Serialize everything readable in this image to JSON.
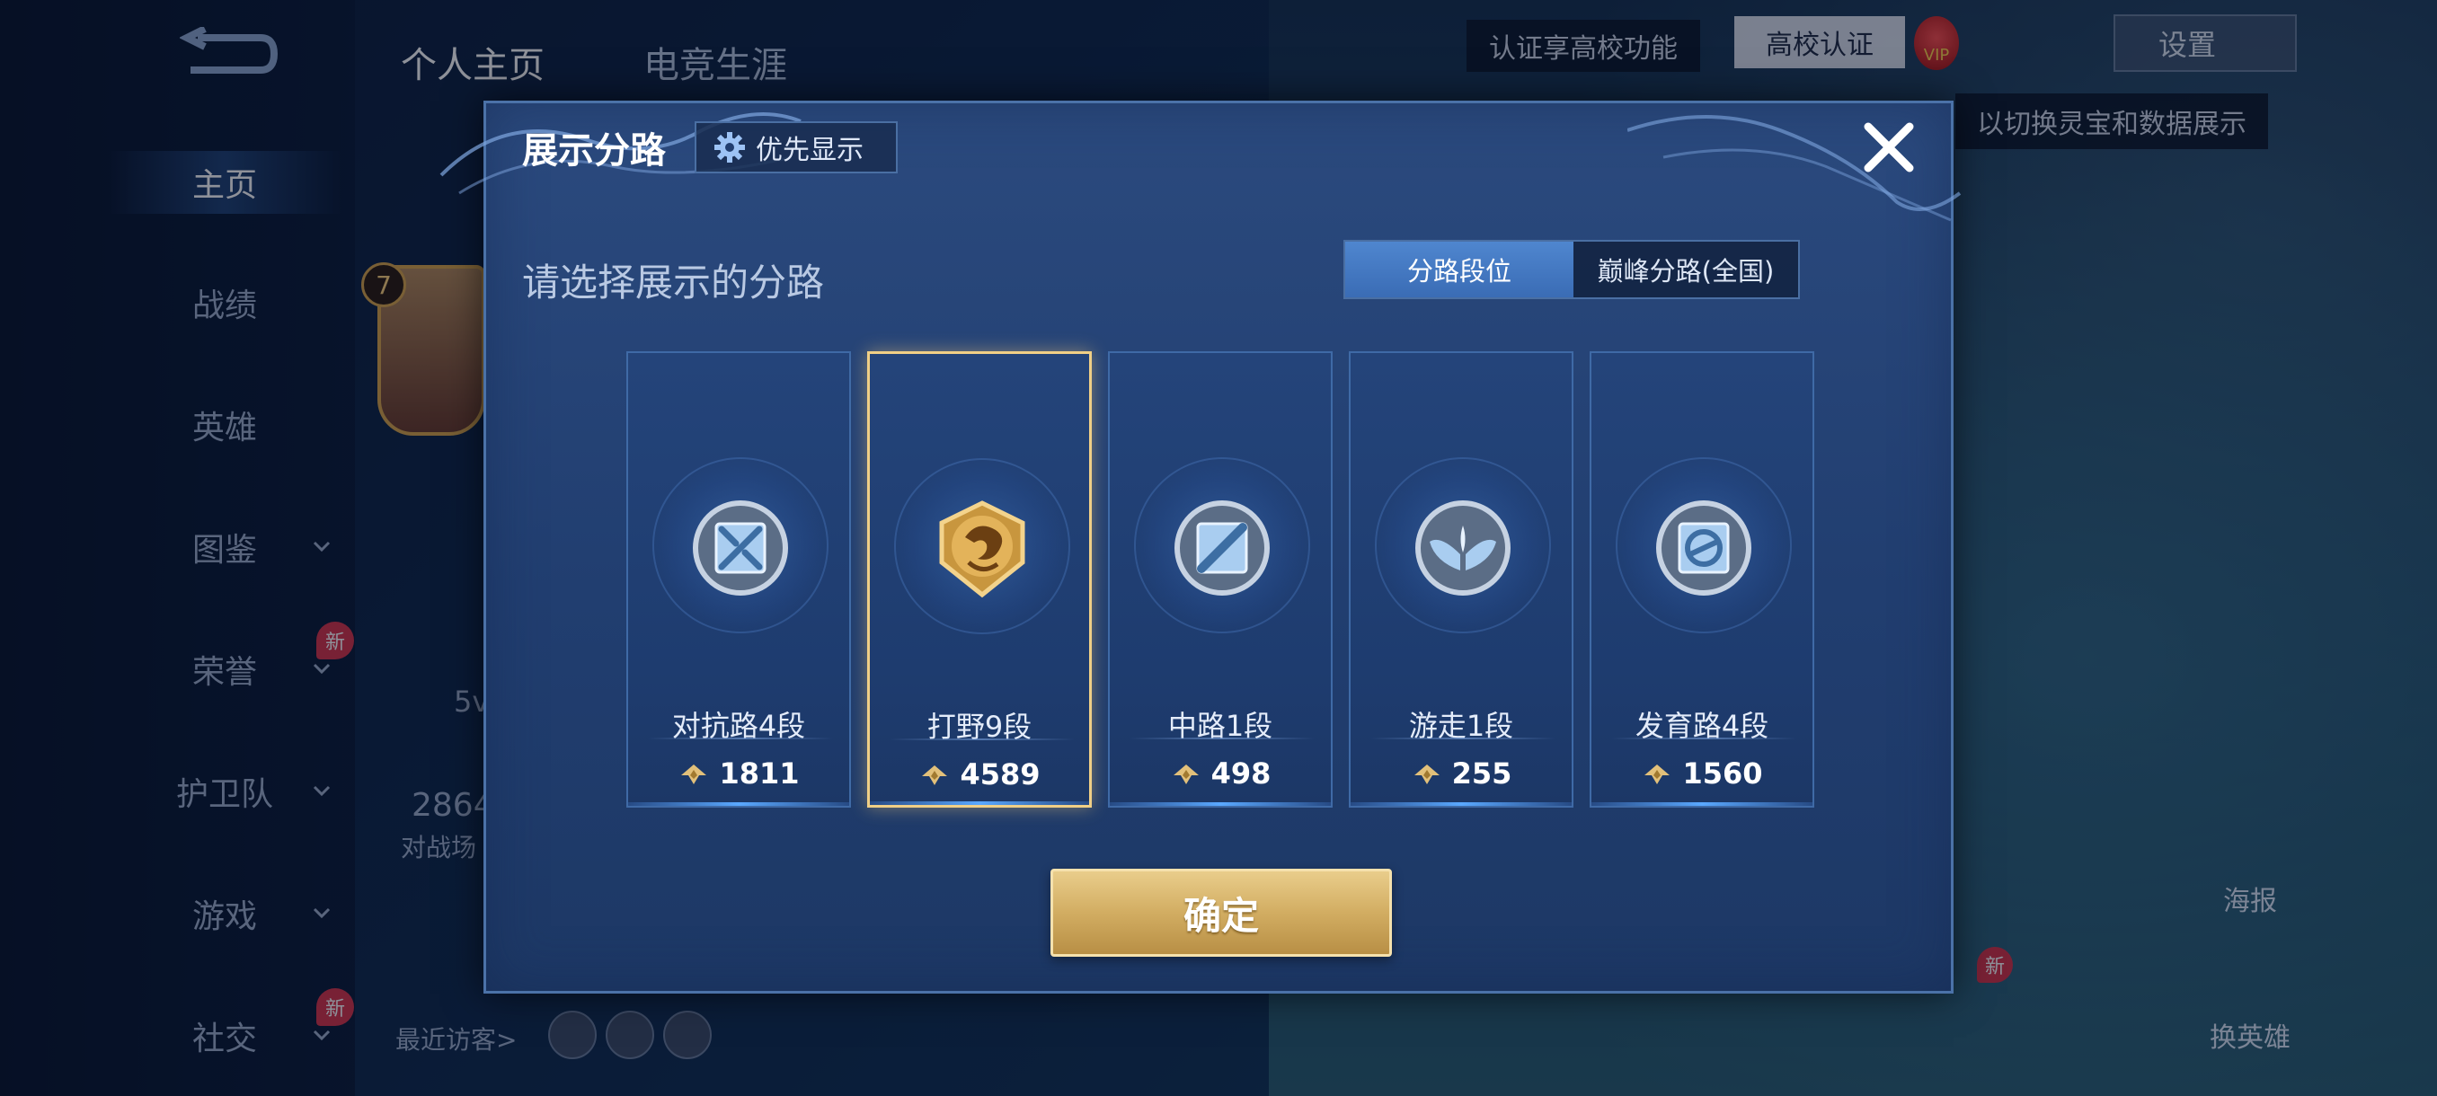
{
  "background": {
    "back_icon": "back-arrow-icon",
    "top_tabs": [
      "个人主页",
      "电竞生涯"
    ],
    "sidebar": [
      {
        "label": "主页",
        "active": true,
        "chevron": false,
        "new": false
      },
      {
        "label": "战绩",
        "active": false,
        "chevron": false,
        "new": false
      },
      {
        "label": "英雄",
        "active": false,
        "chevron": false,
        "new": false
      },
      {
        "label": "图鉴",
        "active": false,
        "chevron": true,
        "new": false
      },
      {
        "label": "荣誉",
        "active": false,
        "chevron": true,
        "new": true
      },
      {
        "label": "护卫队",
        "active": false,
        "chevron": true,
        "new": false
      },
      {
        "label": "游戏",
        "active": false,
        "chevron": true,
        "new": false
      },
      {
        "label": "社交",
        "active": false,
        "chevron": true,
        "new": true
      }
    ],
    "new_badge": "新",
    "header": {
      "campus_tip": "认证享高校功能",
      "campus_cert": "高校认证",
      "vip_label": "VIP",
      "settings_label": "设置",
      "hint_text": "以切换灵宝和数据展示"
    },
    "avatar_level": "7",
    "partial_texts": [
      "5v",
      "2864",
      "对战场"
    ],
    "recent_visitors": "最近访客>",
    "right_actions": {
      "poster": "海报",
      "change_hero": "换英雄"
    },
    "new_badge_right": "新"
  },
  "modal": {
    "title": "展示分路",
    "priority_label": "优先显示",
    "section_title": "请选择展示的分路",
    "tabs": [
      {
        "label": "分路段位",
        "active": true
      },
      {
        "label": "巅峰分路(全国)",
        "active": false
      }
    ],
    "lanes": [
      {
        "rank": "对抗路4段",
        "score": "1811",
        "icon": "clash-lane-icon",
        "selected": false
      },
      {
        "rank": "打野9段",
        "score": "4589",
        "icon": "jungle-dragon-icon",
        "selected": true
      },
      {
        "rank": "中路1段",
        "score": "498",
        "icon": "mid-lane-icon",
        "selected": false
      },
      {
        "rank": "游走1段",
        "score": "255",
        "icon": "roam-wings-icon",
        "selected": false
      },
      {
        "rank": "发育路4段",
        "score": "1560",
        "icon": "farm-lane-icon",
        "selected": false
      }
    ],
    "confirm_label": "确定",
    "colors": {
      "accent_gold": "#e9cd8b",
      "selected_border": "#f0cf86",
      "tab_active": "#4f86cf"
    }
  }
}
